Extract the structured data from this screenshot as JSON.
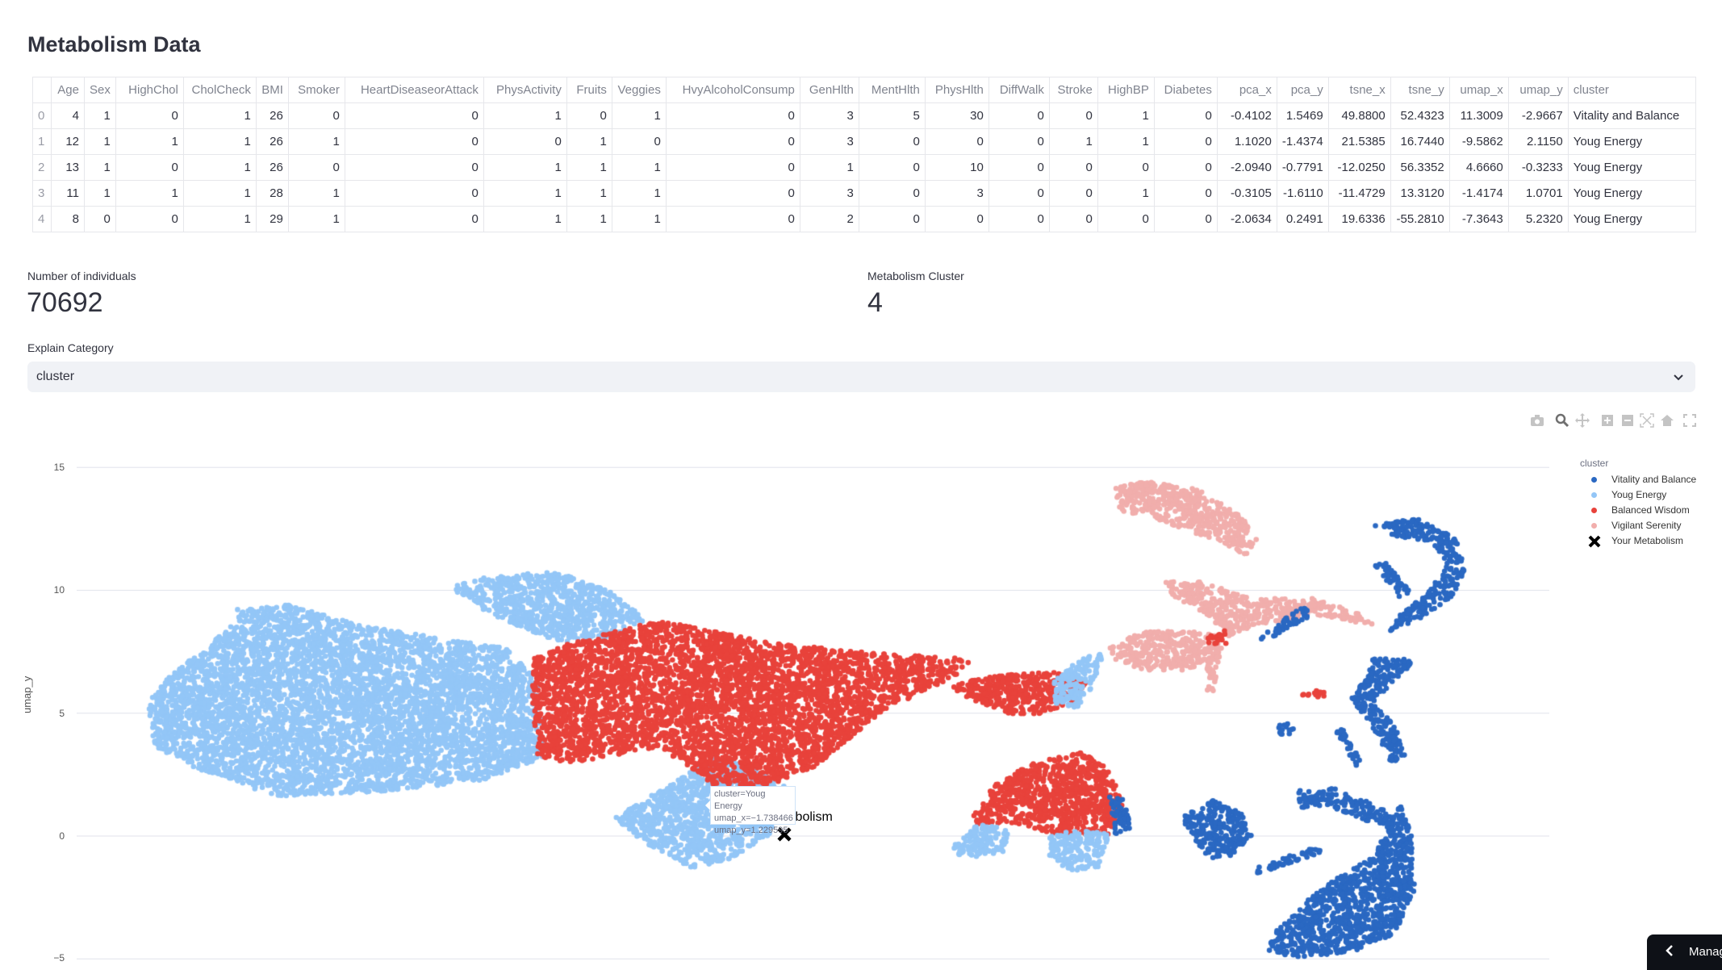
{
  "page_title": "Metabolism Data",
  "table": {
    "columns": [
      "",
      "Age",
      "Sex",
      "HighChol",
      "CholCheck",
      "BMI",
      "Smoker",
      "HeartDiseaseorAttack",
      "PhysActivity",
      "Fruits",
      "Veggies",
      "HvyAlcoholConsump",
      "GenHlth",
      "MentHlth",
      "PhysHlth",
      "DiffWalk",
      "Stroke",
      "HighBP",
      "Diabetes",
      "pca_x",
      "pca_y",
      "tsne_x",
      "tsne_y",
      "umap_x",
      "umap_y",
      "cluster"
    ],
    "rows": [
      [
        "0",
        "4",
        "1",
        "0",
        "1",
        "26",
        "0",
        "0",
        "1",
        "0",
        "1",
        "0",
        "3",
        "5",
        "30",
        "0",
        "0",
        "1",
        "0",
        "-0.4102",
        "1.5469",
        "49.8800",
        "52.4323",
        "11.3009",
        "-2.9667",
        "Vitality and Balance"
      ],
      [
        "1",
        "12",
        "1",
        "1",
        "1",
        "26",
        "1",
        "0",
        "0",
        "1",
        "0",
        "0",
        "3",
        "0",
        "0",
        "0",
        "1",
        "1",
        "0",
        "1.1020",
        "-1.4374",
        "21.5385",
        "16.7440",
        "-9.5862",
        "2.1150",
        "Youg Energy"
      ],
      [
        "2",
        "13",
        "1",
        "0",
        "1",
        "26",
        "0",
        "0",
        "1",
        "1",
        "1",
        "0",
        "1",
        "0",
        "10",
        "0",
        "0",
        "0",
        "0",
        "-2.0940",
        "-0.7791",
        "-12.0250",
        "56.3352",
        "4.6660",
        "-0.3233",
        "Youg Energy"
      ],
      [
        "3",
        "11",
        "1",
        "1",
        "1",
        "28",
        "1",
        "0",
        "1",
        "1",
        "1",
        "0",
        "3",
        "0",
        "3",
        "0",
        "0",
        "1",
        "0",
        "-0.3105",
        "-1.6110",
        "-11.4729",
        "13.3120",
        "-1.4174",
        "1.0701",
        "Youg Energy"
      ],
      [
        "4",
        "8",
        "0",
        "0",
        "1",
        "29",
        "1",
        "0",
        "1",
        "1",
        "1",
        "0",
        "2",
        "0",
        "0",
        "0",
        "0",
        "0",
        "0",
        "-2.0634",
        "0.2491",
        "19.6336",
        "-55.2810",
        "-7.3643",
        "5.2320",
        "Youg Energy"
      ]
    ]
  },
  "metrics": [
    {
      "label": "Number of individuals",
      "value": "70692"
    },
    {
      "label": "Metabolism Cluster",
      "value": "4"
    }
  ],
  "explain": {
    "label": "Explain Category",
    "selected": "cluster"
  },
  "toolbar": [
    "camera-icon",
    "zoom-icon",
    "pan-icon",
    "zoom-in-icon",
    "zoom-out-icon",
    "autoscale-icon",
    "home-icon",
    "fullscreen-icon"
  ],
  "chart_data": {
    "type": "scatter",
    "ylabel": "umap_y",
    "yticks": [
      "15",
      "10",
      "5",
      "0",
      "−5"
    ],
    "grid": true,
    "legend_position": "right",
    "legend_title": "cluster",
    "series": [
      {
        "name": "Vitality and Balance",
        "color": "#2a68c2"
      },
      {
        "name": "Youg Energy",
        "color": "#93c6f7"
      },
      {
        "name": "Balanced Wisdom",
        "color": "#e8423b"
      },
      {
        "name": "Vigilant Serenity",
        "color": "#f1aeac"
      },
      {
        "name": "Your Metabolism",
        "color": "#000000",
        "marker": "x"
      }
    ],
    "marker_label": "Your Metabolism",
    "tooltip": {
      "cluster": "cluster=Youg Energy",
      "umap_x": "umap_x=−1.738466",
      "umap_y": "umap_y=1.229595"
    }
  },
  "manage_app": "Manage app"
}
